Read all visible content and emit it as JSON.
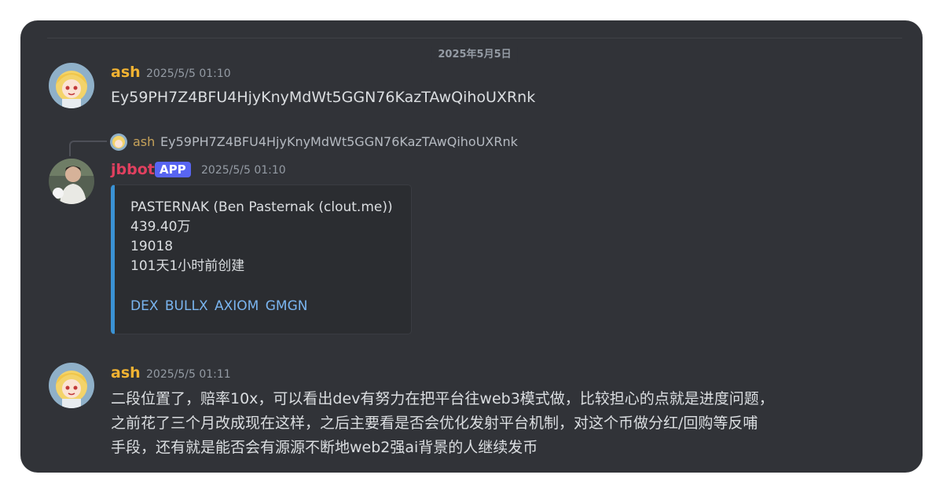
{
  "date_divider": "2025年5月5日",
  "messages": [
    {
      "author": "ash",
      "author_color": "#f0b232",
      "timestamp": "2025/5/5 01:10",
      "text": "Ey59PH7Z4BFU4HjyKnyMdWt5GGN76KazTAwQihoUXRnk"
    },
    {
      "reply_to": {
        "author": "ash",
        "text": "Ey59PH7Z4BFU4HjyKnyMdWt5GGN76KazTAwQihoUXRnk"
      },
      "author": "jbbot",
      "author_color": "#e0405f",
      "badge": "APP",
      "timestamp": "2025/5/5 01:10",
      "embed": {
        "accent": "#3a92d4",
        "lines": [
          "PASTERNAK (Ben Pasternak (clout.me))",
          "439.40万",
          "19018",
          "101天1小时前创建"
        ],
        "links": [
          "DEX",
          "BULLX",
          "AXIOM",
          "GMGN"
        ]
      }
    },
    {
      "author": "ash",
      "author_color": "#f0b232",
      "timestamp": "2025/5/5 01:11",
      "text_lines": [
        "二段位置了，赔率10x，可以看出dev有努力在把平台往web3模式做，比较担心的点就是进度问题，",
        "之前花了三个月改成现在这样，之后主要看是否会优化发射平台机制，对这个币做分红/回购等反哺",
        "手段，还有就是能否会有源源不断地web2强ai背景的人继续发币"
      ]
    }
  ]
}
